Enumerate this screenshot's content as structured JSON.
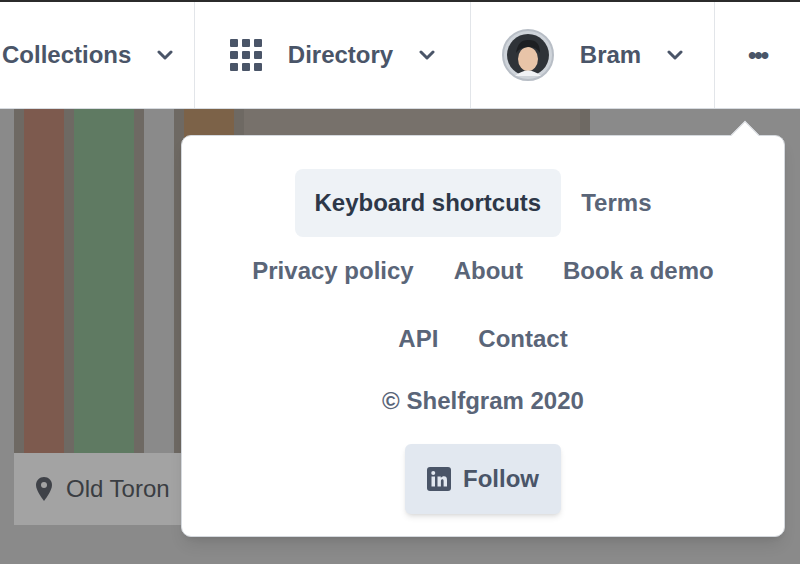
{
  "nav": {
    "items": [
      {
        "label": "Collections",
        "kind": "plain"
      },
      {
        "label": "Directory",
        "kind": "grid"
      },
      {
        "label": "Bram",
        "kind": "avatar"
      }
    ],
    "more": "•••"
  },
  "card": {
    "location": "Old Toron"
  },
  "menu": {
    "rows": [
      [
        {
          "label": "Keyboard shortcuts",
          "highlighted": true
        },
        {
          "label": "Terms",
          "highlighted": false
        }
      ],
      [
        {
          "label": "Privacy policy",
          "highlighted": false
        },
        {
          "label": "About",
          "highlighted": false
        },
        {
          "label": "Book a demo",
          "highlighted": false
        }
      ],
      [
        {
          "label": "API",
          "highlighted": false
        },
        {
          "label": "Contact",
          "highlighted": false
        }
      ]
    ],
    "copyright": "© Shelfgram 2020",
    "follow_button": "Follow"
  }
}
